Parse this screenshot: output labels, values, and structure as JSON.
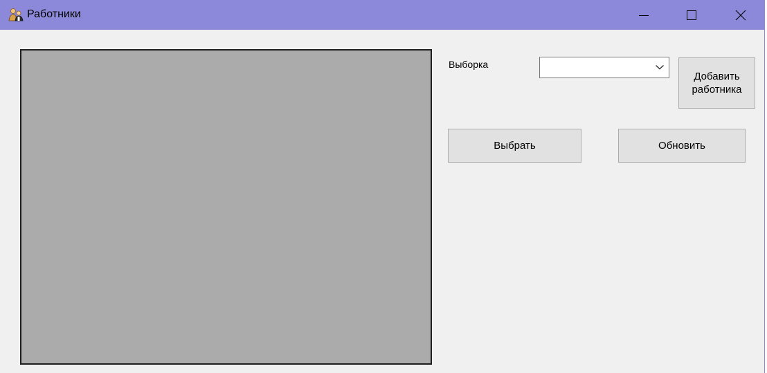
{
  "window": {
    "title": "Работники",
    "icon": "workers-icon",
    "controls": {
      "minimize": "minimize-icon",
      "maximize": "maximize-icon",
      "close": "close-icon"
    },
    "titlebar_color": "#8c89da"
  },
  "main": {
    "grid_background": "#ababab",
    "filter": {
      "label": "Выборка",
      "value": ""
    },
    "buttons": {
      "add_label": "Добавить\nработника",
      "select_label": "Выбрать",
      "refresh_label": "Обновить"
    }
  }
}
